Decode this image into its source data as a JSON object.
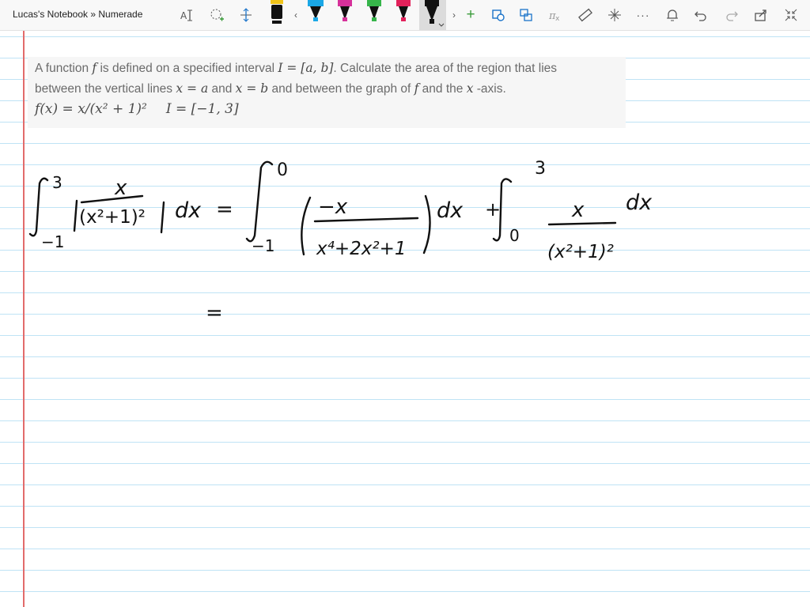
{
  "window": {
    "title": "Lucas's Notebook » Numerade"
  },
  "toolbar": {
    "icons": [
      "text-select-icon",
      "lasso-select-icon",
      "add-space-icon",
      "pen-black-icon",
      "chevron-left-icon",
      "pen-blue-icon",
      "pen-magenta-icon",
      "pen-green-icon",
      "pen-red-icon",
      "pen-black-selected-icon",
      "chevron-right-icon",
      "add-pen-icon",
      "shapes-icon",
      "ink-to-shape-icon",
      "ink-to-math-icon",
      "ruler-icon",
      "crosshair-icon",
      "more-icon",
      "bell-icon",
      "undo-icon",
      "redo-icon",
      "share-icon",
      "fullscreen-icon"
    ],
    "colors": {
      "black": "#111111",
      "blue": "#1aa7e6",
      "magenta": "#d6319a",
      "green": "#36b54a",
      "red": "#e2215a",
      "add": "#3a9b3a"
    }
  },
  "problem": {
    "line1_a": "A function ",
    "line1_f": "f",
    "line1_b": " is defined on a specified interval ",
    "line1_interval": "I = [a, b]",
    "line1_c": ". Calculate the area of the region that lies",
    "line2_a": "between the vertical lines ",
    "line2_xa": "x = a",
    "line2_b": " and ",
    "line2_xb": "x = b",
    "line2_c": " and between the graph of ",
    "line2_f": "f",
    "line2_d": " and the ",
    "line2_x": "x",
    "line2_e": " -axis.",
    "line3_func": "f(x) = x/(x² + 1)²",
    "line3_interval": "I = [−1, 3]"
  },
  "handwriting": {
    "lhs_upper": "3",
    "lhs_lower": "−1",
    "lhs_num": "x",
    "lhs_den": "(x²+1)²",
    "lhs_dx": "dx",
    "eq1": "=",
    "i1_upper": "0",
    "i1_lower": "−1",
    "i1_num": "−x",
    "i1_den": "x⁴+2x²+1",
    "i1_dx": "dx",
    "plus": "+",
    "i2_upper": "3",
    "i2_lower": "0",
    "i2_num": "x",
    "i2_den": "(x²+1)²",
    "i2_dx": "dx",
    "eq2": "="
  }
}
